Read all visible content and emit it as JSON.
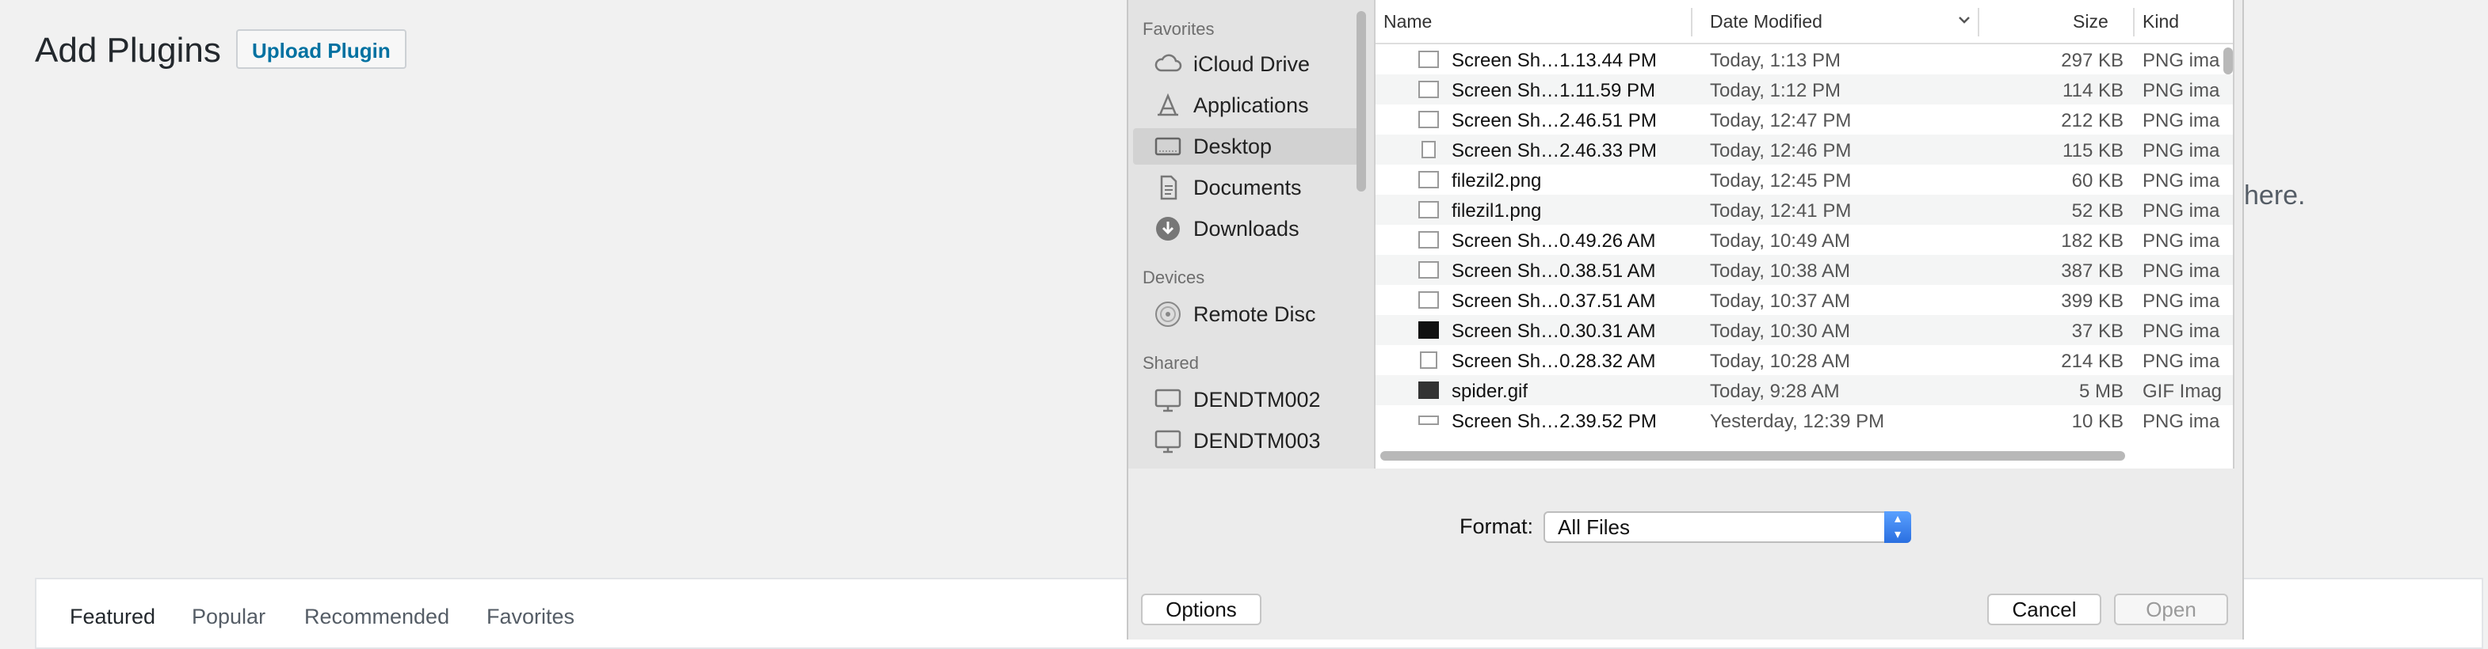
{
  "wp": {
    "title": "Add Plugins",
    "upload_button": "Upload Plugin",
    "bg_text": "here.",
    "tabs": [
      "Featured",
      "Popular",
      "Recommended",
      "Favorites"
    ]
  },
  "sidebar": {
    "favorites_label": "Favorites",
    "favorites": [
      {
        "label": "iCloud Drive",
        "icon": "cloud-icon"
      },
      {
        "label": "Applications",
        "icon": "applications-icon"
      },
      {
        "label": "Desktop",
        "icon": "desktop-icon",
        "selected": true
      },
      {
        "label": "Documents",
        "icon": "document-icon"
      },
      {
        "label": "Downloads",
        "icon": "download-icon"
      }
    ],
    "devices_label": "Devices",
    "devices": [
      {
        "label": "Remote Disc",
        "icon": "disc-icon"
      }
    ],
    "shared_label": "Shared",
    "shared": [
      {
        "label": "DENDTM002",
        "icon": "monitor-icon"
      },
      {
        "label": "DENDTM003",
        "icon": "monitor-icon"
      }
    ]
  },
  "filelist": {
    "columns": {
      "name": "Name",
      "date": "Date Modified",
      "size": "Size",
      "kind": "Kind"
    },
    "rows": [
      {
        "name": "Screen Sh…1.13.44 PM",
        "date": "Today, 1:13 PM",
        "size": "297 KB",
        "kind": "PNG ima"
      },
      {
        "name": "Screen Sh…1.11.59 PM",
        "date": "Today, 1:12 PM",
        "size": "114 KB",
        "kind": "PNG ima"
      },
      {
        "name": "Screen Sh…2.46.51 PM",
        "date": "Today, 12:47 PM",
        "size": "212 KB",
        "kind": "PNG ima"
      },
      {
        "name": "Screen Sh…2.46.33 PM",
        "date": "Today, 12:46 PM",
        "size": "115 KB",
        "kind": "PNG ima"
      },
      {
        "name": "filezil2.png",
        "date": "Today, 12:45 PM",
        "size": "60 KB",
        "kind": "PNG ima"
      },
      {
        "name": "filezil1.png",
        "date": "Today, 12:41 PM",
        "size": "52 KB",
        "kind": "PNG ima"
      },
      {
        "name": "Screen Sh…0.49.26 AM",
        "date": "Today, 10:49 AM",
        "size": "182 KB",
        "kind": "PNG ima"
      },
      {
        "name": "Screen Sh…0.38.51 AM",
        "date": "Today, 10:38 AM",
        "size": "387 KB",
        "kind": "PNG ima"
      },
      {
        "name": "Screen Sh…0.37.51 AM",
        "date": "Today, 10:37 AM",
        "size": "399 KB",
        "kind": "PNG ima"
      },
      {
        "name": "Screen Sh…0.30.31 AM",
        "date": "Today, 10:30 AM",
        "size": "37 KB",
        "kind": "PNG ima"
      },
      {
        "name": "Screen Sh…0.28.32 AM",
        "date": "Today, 10:28 AM",
        "size": "214 KB",
        "kind": "PNG ima"
      },
      {
        "name": "spider.gif",
        "date": "Today, 9:28 AM",
        "size": "5 MB",
        "kind": "GIF Imag"
      },
      {
        "name": "Screen Sh…2.39.52 PM",
        "date": "Yesterday, 12:39 PM",
        "size": "10 KB",
        "kind": "PNG ima"
      }
    ]
  },
  "format": {
    "label": "Format:",
    "value": "All Files"
  },
  "buttons": {
    "options": "Options",
    "cancel": "Cancel",
    "open": "Open"
  }
}
